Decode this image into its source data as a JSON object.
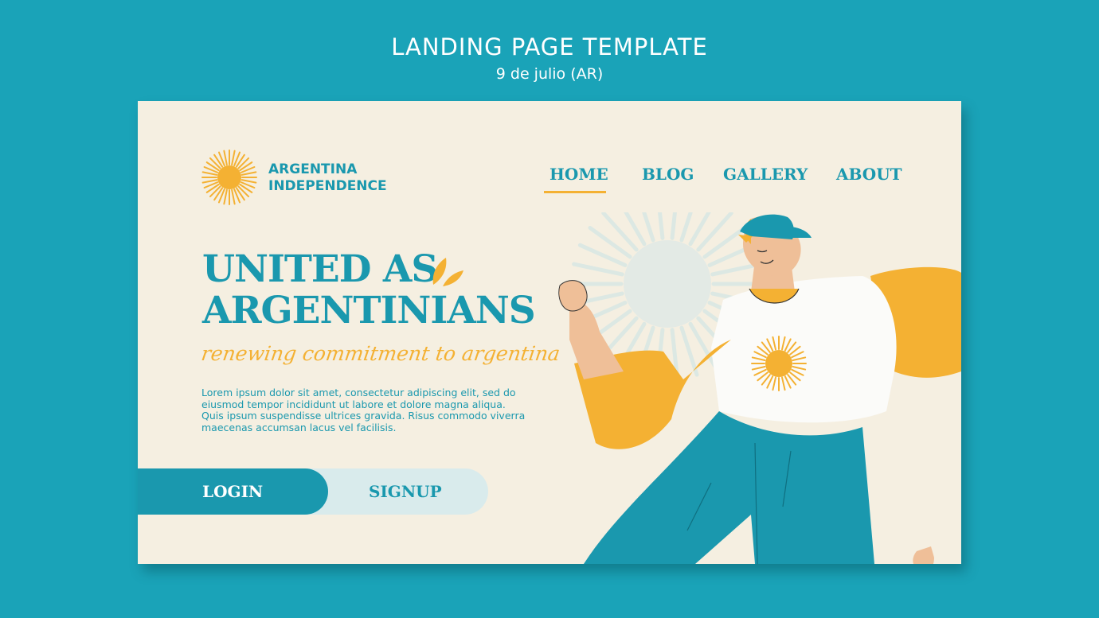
{
  "banner": {
    "title": "LANDING PAGE TEMPLATE",
    "subtitle": "9 de julio (AR)"
  },
  "brand": {
    "line1": "ARGENTINA",
    "line2": "INDEPENDENCE",
    "icon": "sun-icon"
  },
  "nav": {
    "items": [
      {
        "label": "HOME",
        "active": true
      },
      {
        "label": "BLOG",
        "active": false
      },
      {
        "label": "GALLERY",
        "active": false
      },
      {
        "label": "ABOUT",
        "active": false
      }
    ]
  },
  "hero": {
    "headline_line1": "UNITED AS",
    "headline_line2": "ARGENTINIANS",
    "tagline": "renewing commitment to argentina",
    "body": "Lorem ipsum dolor sit amet, consectetur adipiscing elit, sed do eiusmod tempor incididunt ut labore et dolore magna aliqua. Quis ipsum suspendisse ultrices gravida. Risus commodo viverra maecenas accumsan lacus vel facilisis."
  },
  "buttons": {
    "login": "LOGIN",
    "signup": "SIGNUP"
  },
  "colors": {
    "background": "#1aa3b8",
    "card": "#f5efe1",
    "primary": "#1a98ae",
    "accent": "#f4b133",
    "light": "#d9ebec"
  }
}
